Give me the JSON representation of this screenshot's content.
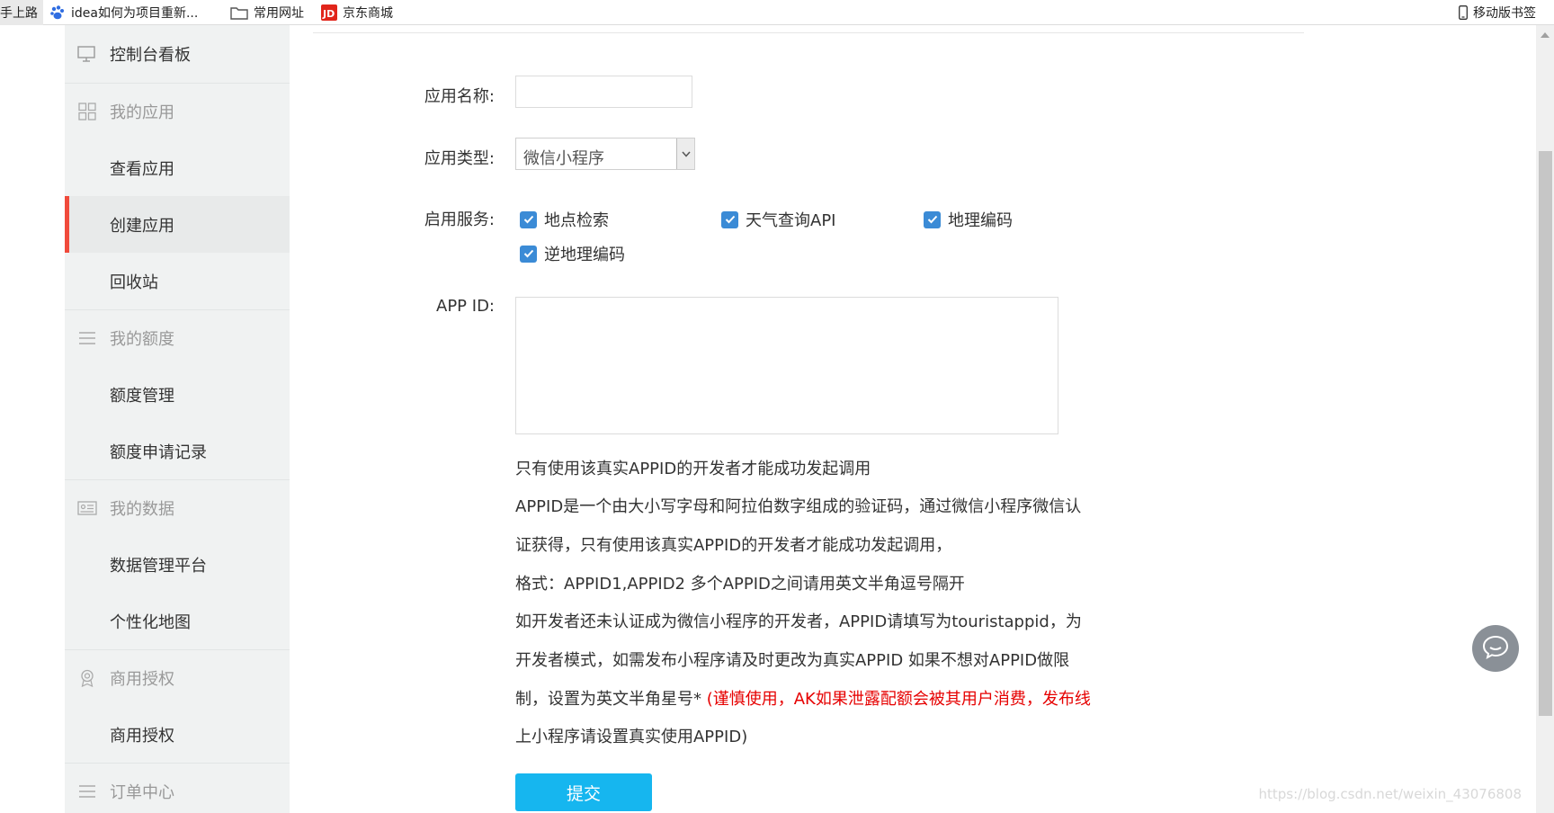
{
  "bookmarks": {
    "items": [
      "手上路",
      "idea如何为项目重新...",
      "常用网址",
      "京东商城"
    ],
    "right": "移动版书签"
  },
  "sidebar": {
    "dashboard": "控制台看板",
    "groups": [
      {
        "label": "我的应用",
        "icon": "grid-icon",
        "items": [
          "查看应用",
          "创建应用",
          "回收站"
        ]
      },
      {
        "label": "我的额度",
        "icon": "list-icon",
        "items": [
          "额度管理",
          "额度申请记录"
        ]
      },
      {
        "label": "我的数据",
        "icon": "id-card-icon",
        "items": [
          "数据管理平台",
          "个性化地图"
        ]
      },
      {
        "label": "商用授权",
        "icon": "award-icon",
        "items": [
          "商用授权"
        ]
      },
      {
        "label": "订单中心",
        "icon": "list-icon",
        "items": []
      }
    ],
    "active": "创建应用"
  },
  "form": {
    "app_name_label": "应用名称:",
    "app_name_value": "",
    "app_type_label": "应用类型:",
    "app_type_value": "微信小程序",
    "services_label": "启用服务:",
    "services": [
      "地点检索",
      "天气查询API",
      "地理编码",
      "逆地理编码"
    ],
    "appid_label": "APP ID:",
    "appid_value": "",
    "notice_red": "只有使用该真实APPID的开发者才能成功发起调用",
    "info_lines": [
      "APPID是一个由大小写字母和阿拉伯数字组成的验证码，通过微信小程序微信认",
      "证获得，只有使用该真实APPID的开发者才能成功发起调用，",
      "格式：APPID1,APPID2 多个APPID之间请用英文半角逗号隔开",
      "如开发者还未认证成为微信小程序的开发者，APPID请填写为touristappid，为",
      "开发者模式，如需发布小程序请及时更改为真实APPID 如果不想对APPID做限",
      "制，设置为英文半角星号*"
    ],
    "warning_part1": " (谨慎使用，AK如果泄露配额会被其用户消费，发布线",
    "warning_part2": "上小程序请设置真实使用APPID)",
    "submit_label": "提交"
  },
  "watermark": "https://blog.csdn.net/weixin_43076808",
  "colors": {
    "accent": "#16b6ef",
    "active_bar": "#f04a3b",
    "warning": "#e60000",
    "checkbox": "#3b8bd6"
  }
}
